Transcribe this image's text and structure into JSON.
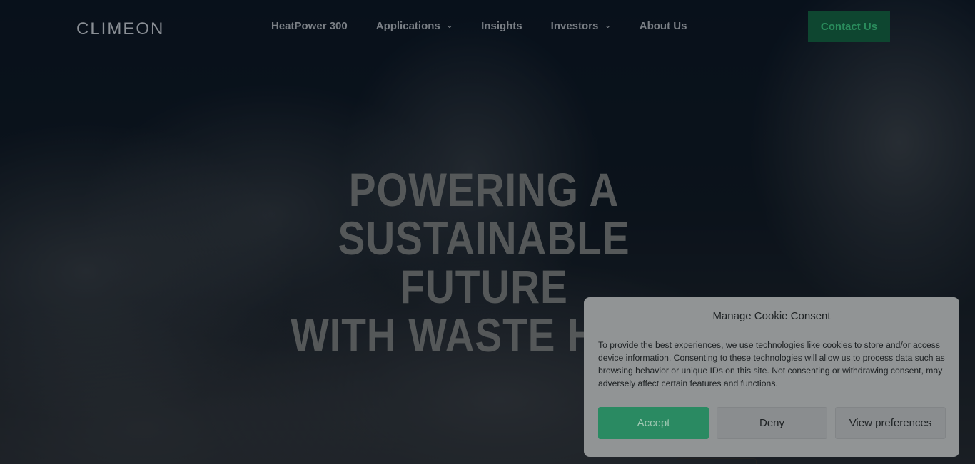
{
  "brand": {
    "logo_text": "CLIMEON"
  },
  "nav": {
    "items": [
      {
        "label": "HeatPower 300",
        "has_dropdown": false
      },
      {
        "label": "Applications",
        "has_dropdown": true
      },
      {
        "label": "Insights",
        "has_dropdown": false
      },
      {
        "label": "Investors",
        "has_dropdown": true
      },
      {
        "label": "About Us",
        "has_dropdown": false
      }
    ],
    "contact_label": "Contact Us"
  },
  "hero": {
    "headline_lines": [
      "POWERING A",
      "SUSTAINABLE FUTURE",
      "WITH WASTE HEAT"
    ]
  },
  "cookie": {
    "title": "Manage Cookie Consent",
    "text": "To provide the best experiences, we use technologies like cookies to store and/or access device information. Consenting to these technologies will allow us to process data such as browsing behavior or unique IDs on this site. Not consenting or withdrawing consent, may adversely affect certain features and functions.",
    "accept_label": "Accept",
    "deny_label": "Deny",
    "preferences_label": "View preferences"
  },
  "colors": {
    "accent_green": "#2a8a62",
    "contact_bg": "#0e4630"
  }
}
